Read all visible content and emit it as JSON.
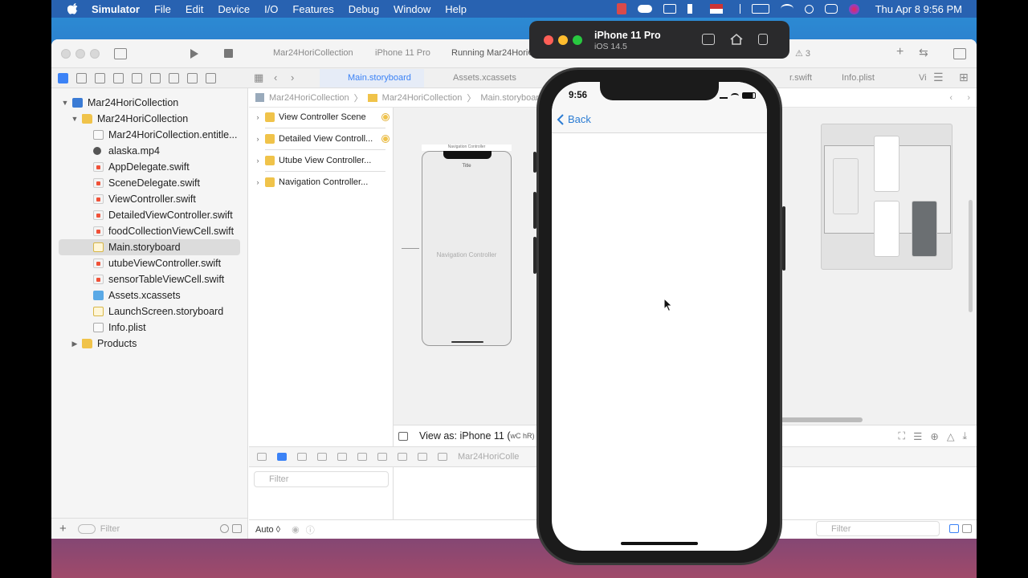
{
  "menubar": {
    "app": "Simulator",
    "items": [
      "File",
      "Edit",
      "Device",
      "I/O",
      "Features",
      "Debug",
      "Window",
      "Help"
    ],
    "clock": "Thu Apr 8  9:56 PM"
  },
  "toolbar": {
    "scheme_project": "Mar24HoriCollection",
    "scheme_device": "iPhone 11 Pro",
    "status": "Running Mar24HoriCo",
    "warnings": "3"
  },
  "tabs": {
    "main_storyboard": "Main.storyboard",
    "assets": "Assets.xcassets",
    "swift_partial": "r.swift",
    "info": "Info.plist",
    "more": "Vi"
  },
  "navigator": {
    "project": "Mar24HoriCollection",
    "group": "Mar24HoriCollection",
    "files": [
      "Mar24HoriCollection.entitle...",
      "alaska.mp4",
      "AppDelegate.swift",
      "SceneDelegate.swift",
      "ViewController.swift",
      "DetailedViewController.swift",
      "foodCollectionViewCell.swift",
      "Main.storyboard",
      "utubeViewController.swift",
      "sensorTableViewCell.swift",
      "Assets.xcassets",
      "LaunchScreen.storyboard",
      "Info.plist"
    ],
    "products": "Products",
    "filter_placeholder": "Filter"
  },
  "breadcrumb": {
    "a": "Mar24HoriCollection",
    "b": "Mar24HoriCollection",
    "c": "Main.storyboard"
  },
  "outline": {
    "scenes": [
      "View Controller Scene",
      "Detailed View Controll...",
      "Utube View Controller...",
      "Navigation Controller..."
    ],
    "filter_placeholder": "Filter"
  },
  "canvas": {
    "nav_header": "Navigation Controller",
    "nav_title": "Title",
    "nav_name": "Navigation Controller",
    "view_as": "View as: iPhone 11 (",
    "view_as_suffix": "wC hR)"
  },
  "debug": {
    "path": "Mar24HoriColle"
  },
  "console": {
    "mode": "Auto ◊",
    "filter_placeholder": "Filter"
  },
  "simulator": {
    "device": "iPhone 11 Pro",
    "os": "iOS 14.5",
    "time": "9:56",
    "back": "Back"
  }
}
